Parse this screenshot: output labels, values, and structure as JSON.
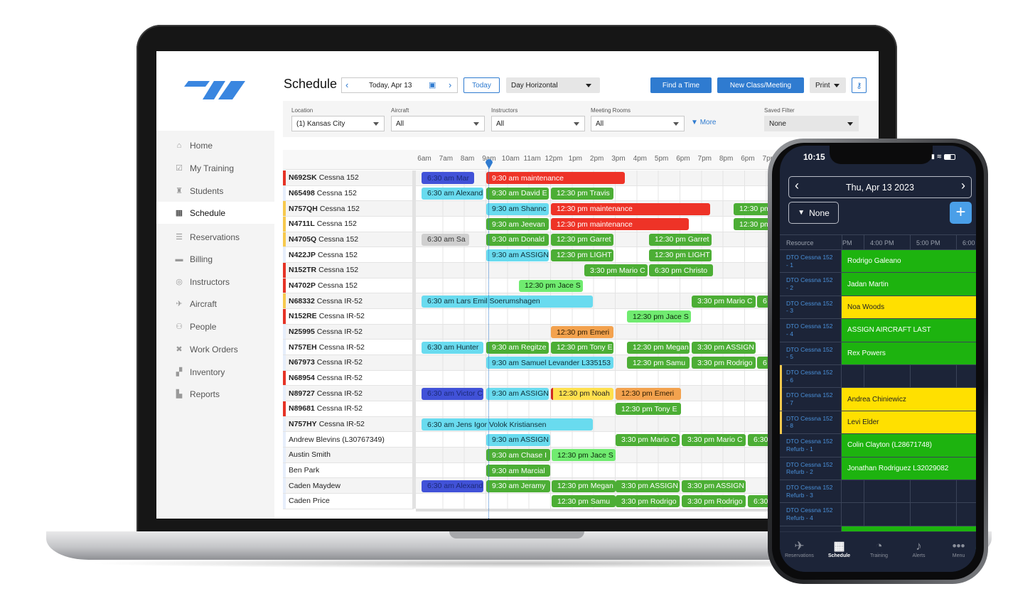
{
  "app": {
    "title": "Schedule",
    "date_label": "Today, Apr 13",
    "today_button": "Today",
    "view_select": "Day Horizontal",
    "find_time_button": "Find a Time",
    "new_class_button": "New Class/Meeting",
    "print_button": "Print",
    "colors": {
      "accent": "#2f7bd0",
      "logo": "#3a86e0"
    }
  },
  "sidebar": {
    "items": [
      {
        "label": "Home",
        "icon": "home-icon"
      },
      {
        "label": "My Training",
        "icon": "checkbox-icon"
      },
      {
        "label": "Students",
        "icon": "student-icon"
      },
      {
        "label": "Schedule",
        "icon": "calendar-icon",
        "active": true
      },
      {
        "label": "Reservations",
        "icon": "list-icon"
      },
      {
        "label": "Billing",
        "icon": "card-icon"
      },
      {
        "label": "Instructors",
        "icon": "headset-icon"
      },
      {
        "label": "Aircraft",
        "icon": "plane-icon"
      },
      {
        "label": "People",
        "icon": "people-icon"
      },
      {
        "label": "Work Orders",
        "icon": "tools-icon"
      },
      {
        "label": "Inventory",
        "icon": "boxes-icon"
      },
      {
        "label": "Reports",
        "icon": "chart-icon"
      }
    ]
  },
  "filters": {
    "location": {
      "label": "Location",
      "value": "(1) Kansas City"
    },
    "aircraft": {
      "label": "Aircraft",
      "value": "All"
    },
    "instructors": {
      "label": "Instructors",
      "value": "All"
    },
    "meeting_rooms": {
      "label": "Meeting Rooms",
      "value": "All"
    },
    "more": "More",
    "saved_filter": {
      "label": "Saved Filter",
      "value": "None"
    }
  },
  "timeline": {
    "hours": [
      "6am",
      "7am",
      "8am",
      "9am",
      "10am",
      "11am",
      "12pm",
      "1pm",
      "2pm",
      "3pm",
      "4pm",
      "5pm",
      "6pm",
      "7pm",
      "8pm",
      "6pm",
      "7pm"
    ],
    "event_colors": {
      "blue": "#4152d8",
      "cyan": "#69dbef",
      "green": "#4cae35",
      "red": "#ee3327",
      "gray": "#cfcfcf",
      "lightgreen": "#70eb70",
      "orange": "#f3a24e",
      "yellow": "#ffe04e"
    }
  },
  "rows": [
    {
      "tail": "N692SK",
      "model": "Cessna 152",
      "marker": "red",
      "events": [
        {
          "label": "6:30 am Mar",
          "kind": "blue"
        },
        {
          "label": "9:30 am maintenance",
          "kind": "red"
        }
      ]
    },
    {
      "tail": "N65498",
      "model": "Cessna 152",
      "marker": "light",
      "events": [
        {
          "label": "6:30 am Alexand",
          "kind": "cyan"
        },
        {
          "label": "9:30 am David E",
          "kind": "green"
        },
        {
          "label": "12:30 pm Travis",
          "kind": "green"
        }
      ]
    },
    {
      "tail": "N757QH",
      "model": "Cessna 152",
      "marker": "yellow",
      "events": [
        {
          "label": "9:30 am Shannc",
          "kind": "cyan"
        },
        {
          "label": "12:30 pm maintenance",
          "kind": "red"
        },
        {
          "label": "12:30 pm",
          "kind": "green"
        }
      ]
    },
    {
      "tail": "N4711L",
      "model": "Cessna 152",
      "marker": "yellow",
      "events": [
        {
          "label": "9:30 am Jeevan",
          "kind": "green"
        },
        {
          "label": "12:30 pm maintenance",
          "kind": "red"
        },
        {
          "label": "12:30 pm",
          "kind": "green"
        }
      ]
    },
    {
      "tail": "N4705Q",
      "model": "Cessna 152",
      "marker": "yellow",
      "events": [
        {
          "label": "6:30 am Sa",
          "kind": "gray"
        },
        {
          "label": "9:30 am Donald",
          "kind": "green"
        },
        {
          "label": "12:30 pm Garret",
          "kind": "green"
        },
        {
          "label": "12:30 pm Garret",
          "kind": "green"
        }
      ]
    },
    {
      "tail": "N422JP",
      "model": "Cessna 152",
      "marker": "light",
      "events": [
        {
          "label": "9:30 am ASSIGN",
          "kind": "cyan"
        },
        {
          "label": "12:30 pm LIGHT",
          "kind": "green"
        },
        {
          "label": "12:30 pm LIGHT",
          "kind": "green"
        }
      ]
    },
    {
      "tail": "N152TR",
      "model": "Cessna 152",
      "marker": "red",
      "events": [
        {
          "label": "3:30 pm Mario C",
          "kind": "green"
        },
        {
          "label": "6:30 pm Christo",
          "kind": "green"
        }
      ]
    },
    {
      "tail": "N4702P",
      "model": "Cessna 152",
      "marker": "red",
      "events": [
        {
          "label": "12:30 pm Jace S",
          "kind": "lightgreen"
        }
      ]
    },
    {
      "tail": "N68332",
      "model": "Cessna IR-52",
      "marker": "yellow",
      "events": [
        {
          "label": "6:30 am Lars Emil Soerumshagen",
          "kind": "cyan"
        },
        {
          "label": "3:30 pm Mario C",
          "kind": "green"
        },
        {
          "label": "6",
          "kind": "green"
        }
      ]
    },
    {
      "tail": "N152RE",
      "model": "Cessna IR-52",
      "marker": "red",
      "events": [
        {
          "label": "12:30 pm Jace S",
          "kind": "lightgreen"
        }
      ]
    },
    {
      "tail": "N25995",
      "model": "Cessna IR-52",
      "marker": "light",
      "events": [
        {
          "label": "12:30 pm Emeri",
          "kind": "orange"
        }
      ]
    },
    {
      "tail": "N757EH",
      "model": "Cessna IR-52",
      "marker": "light",
      "events": [
        {
          "label": "6:30 am Hunter",
          "kind": "cyan"
        },
        {
          "label": "9:30 am Regitze",
          "kind": "green"
        },
        {
          "label": "12:30 pm Tony E",
          "kind": "green"
        },
        {
          "label": "12:30 pm Megan",
          "kind": "green"
        },
        {
          "label": "3:30 pm ASSIGN",
          "kind": "green"
        }
      ]
    },
    {
      "tail": "N67973",
      "model": "Cessna IR-52",
      "marker": "light",
      "events": [
        {
          "label": "9:30 am Samuel Levander L335153",
          "kind": "cyan"
        },
        {
          "label": "12:30 pm Samu",
          "kind": "green"
        },
        {
          "label": "3:30 pm Rodrigo",
          "kind": "green"
        },
        {
          "label": "6",
          "kind": "green"
        }
      ]
    },
    {
      "tail": "N68954",
      "model": "Cessna IR-52",
      "marker": "red",
      "events": []
    },
    {
      "tail": "N89727",
      "model": "Cessna IR-52",
      "marker": "light",
      "events": [
        {
          "label": "6:30 am Victor C",
          "kind": "blue"
        },
        {
          "label": "9:30 am ASSIGN",
          "kind": "cyan"
        },
        {
          "label": "12:30 pm Noah",
          "kind": "yellow"
        },
        {
          "label": "12:30 pm Emeri",
          "kind": "orange"
        }
      ]
    },
    {
      "tail": "N89681",
      "model": "Cessna IR-52",
      "marker": "red",
      "events": [
        {
          "label": "12:30 pm Tony E",
          "kind": "green"
        }
      ]
    },
    {
      "tail": "N757HY",
      "model": "Cessna IR-52",
      "marker": "light",
      "events": [
        {
          "label": "6:30 am Jens Igor Volok Kristiansen",
          "kind": "cyan"
        }
      ]
    },
    {
      "name": "Andrew Blevins (L30767349)",
      "marker": "light",
      "events": [
        {
          "label": "9:30 am ASSIGN",
          "kind": "cyan"
        },
        {
          "label": "3:30 pm Mario C",
          "kind": "green"
        },
        {
          "label": "3:30 pm Mario C",
          "kind": "green"
        },
        {
          "label": "6:30",
          "kind": "green"
        }
      ]
    },
    {
      "name": "Austin Smith",
      "marker": "light",
      "events": [
        {
          "label": "9:30 am Chase I",
          "kind": "green"
        },
        {
          "label": "12:30 pm Jace S",
          "kind": "lightgreen"
        }
      ]
    },
    {
      "name": "Ben Park",
      "marker": "light",
      "events": [
        {
          "label": "9:30 am Marcial",
          "kind": "green"
        }
      ]
    },
    {
      "name": "Caden Maydew",
      "marker": "light",
      "events": [
        {
          "label": "6:30 am Alexand",
          "kind": "blue"
        },
        {
          "label": "9:30 am Jeramy",
          "kind": "green"
        },
        {
          "label": "12:30 pm Megan",
          "kind": "green"
        },
        {
          "label": "3:30 pm ASSIGN",
          "kind": "green"
        },
        {
          "label": "3:30 pm ASSIGN",
          "kind": "green"
        }
      ]
    },
    {
      "name": "Caden Price",
      "marker": "light",
      "events": [
        {
          "label": "12:30 pm Samu",
          "kind": "green"
        },
        {
          "label": "3:30 pm Rodrigo",
          "kind": "green"
        },
        {
          "label": "3:30 pm Rodrigo",
          "kind": "green"
        },
        {
          "label": "6:30",
          "kind": "green"
        }
      ]
    }
  ],
  "phone": {
    "time": "10:15",
    "date": "Thu, Apr 13 2023",
    "filter": "None",
    "resource_header": "Resource",
    "hours": [
      "PM",
      "4:00 PM",
      "5:00 PM",
      "6:00"
    ],
    "rows": [
      {
        "resource": "DTO Cessna 152\n- 1",
        "event": "Rodrigo Galeano",
        "kind": "green"
      },
      {
        "resource": "DTO Cessna 152\n- 2",
        "event": "Jadan Martin",
        "kind": "green"
      },
      {
        "resource": "DTO Cessna 152\n- 3",
        "event": "Noa Woods",
        "kind": "yellow"
      },
      {
        "resource": "DTO Cessna 152\n- 4",
        "event": "ASSIGN AIRCRAFT LAST",
        "kind": "green"
      },
      {
        "resource": "DTO Cessna 152\n- 5",
        "event": "Rex Powers",
        "kind": "green"
      },
      {
        "resource": "DTO Cessna 152\n- 6",
        "event": "",
        "kind": "",
        "marker": true
      },
      {
        "resource": "DTO Cessna 152\n- 7",
        "event": "Andrea Chiniewicz",
        "kind": "yellow",
        "marker": true
      },
      {
        "resource": "DTO Cessna 152\n- 8",
        "event": "Levi Elder",
        "kind": "yellow",
        "marker": true
      },
      {
        "resource": "DTO Cessna 152\nRefurb - 1",
        "event": "Colin Clayton (L28671748)",
        "kind": "green"
      },
      {
        "resource": "DTO Cessna 152\nRefurb - 2",
        "event": "Jonathan Rodriguez   L32029082",
        "kind": "green"
      },
      {
        "resource": "DTO Cessna 152\nRefurb - 3",
        "event": "",
        "kind": ""
      },
      {
        "resource": "DTO Cessna 152\nRefurb - 4",
        "event": "",
        "kind": ""
      },
      {
        "resource": "",
        "event": "",
        "kind": "green"
      }
    ],
    "tabs": [
      {
        "label": "Reservations",
        "icon": "plane-icon"
      },
      {
        "label": "Schedule",
        "icon": "calendar-icon",
        "active": true
      },
      {
        "label": "Training",
        "icon": "gauge-icon"
      },
      {
        "label": "Alerts",
        "icon": "bell-icon"
      },
      {
        "label": "Menu",
        "icon": "more-icon"
      }
    ],
    "colors": {
      "bg": "#1c2438",
      "green": "#1db30f",
      "yellow": "#ffe000",
      "plus": "#4a9fe8"
    }
  }
}
